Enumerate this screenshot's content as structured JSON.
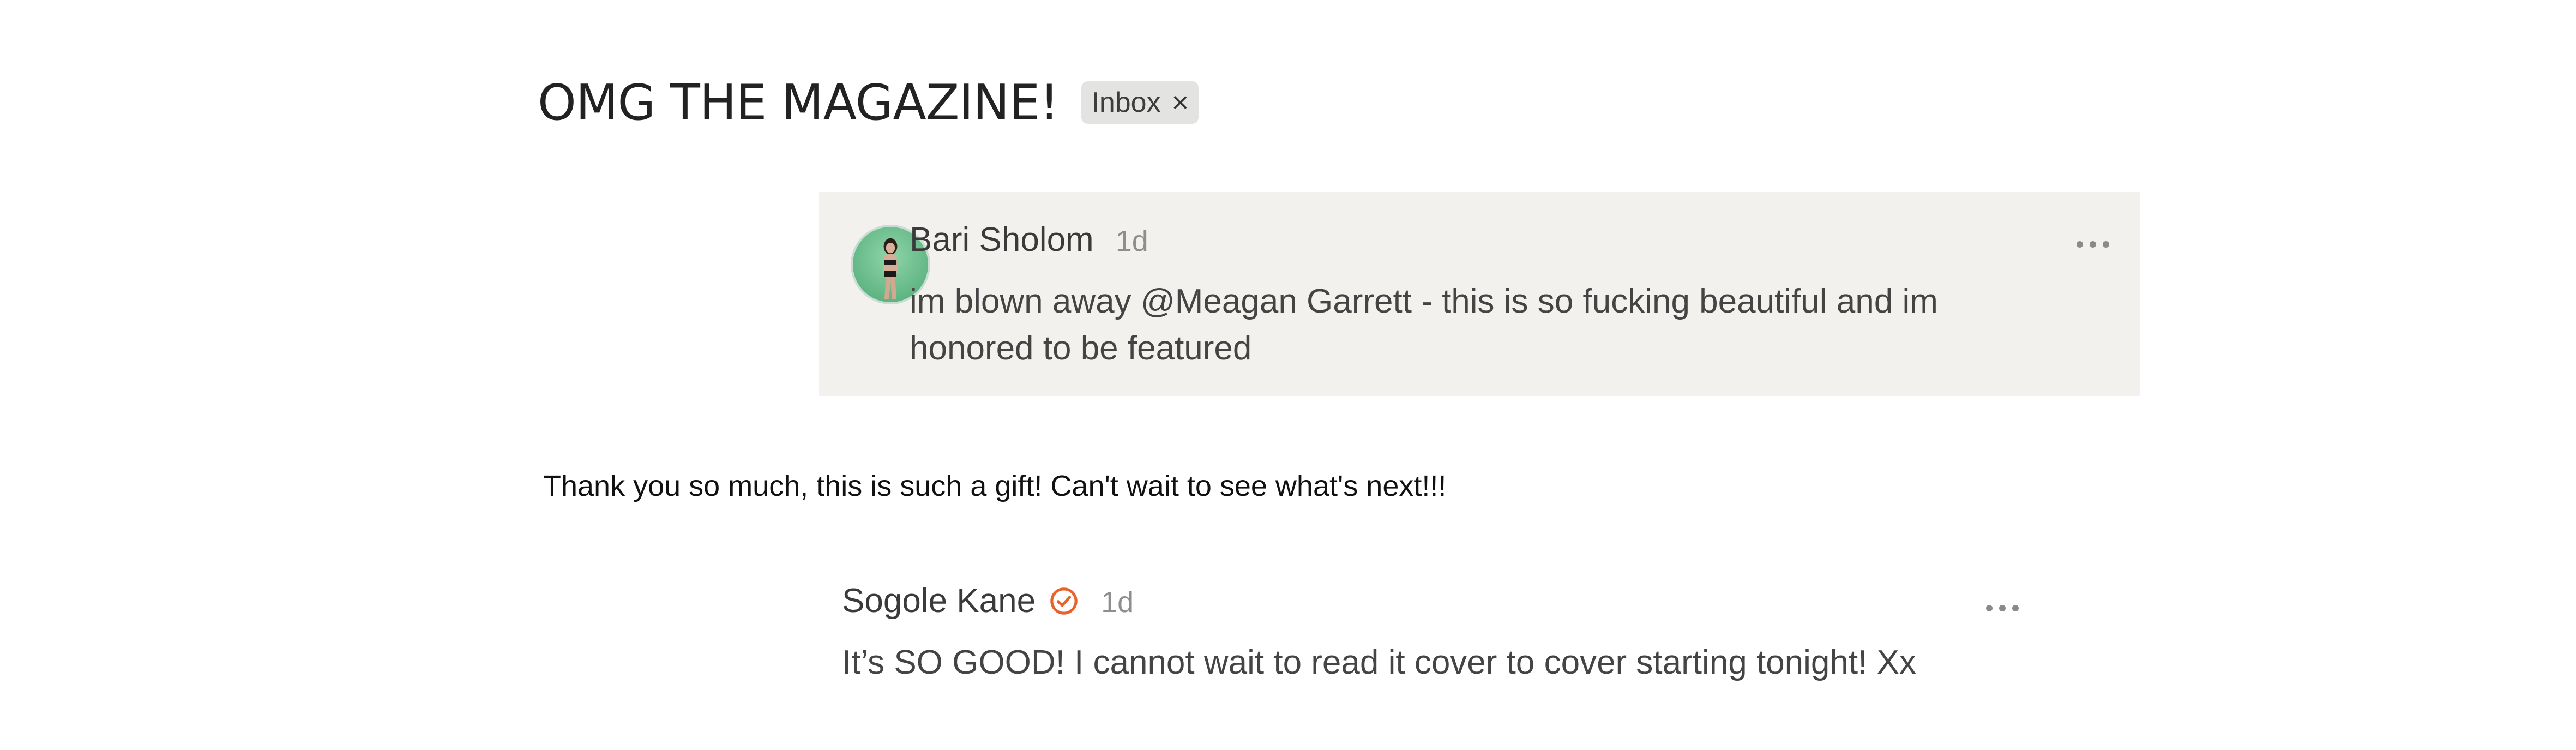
{
  "header": {
    "title": "OMG THE MAGAZINE!",
    "chip_label": "Inbox",
    "chip_close": "×"
  },
  "comments": [
    {
      "author": "Bari Sholom",
      "time": "1d",
      "text": "im blown away @Meagan Garrett - this is so fucking beautiful and im honored to be featured",
      "avatar_icon": "avatar-photo",
      "more_icon": "more-icon"
    },
    {
      "author": "Sogole Kane",
      "time": "1d",
      "text": "It’s SO GOOD! I cannot wait to read it cover to cover starting tonight! Xx",
      "badge_icon": "verified-check-icon",
      "more_icon": "more-icon"
    }
  ],
  "reply": {
    "text": "Thank you so much, this is such a gift! Can't wait to see what's next!!!"
  },
  "colors": {
    "highlight_bg": "#f2f1ee",
    "chip_bg": "#e3e3e1",
    "verified_orange": "#e8632a"
  }
}
